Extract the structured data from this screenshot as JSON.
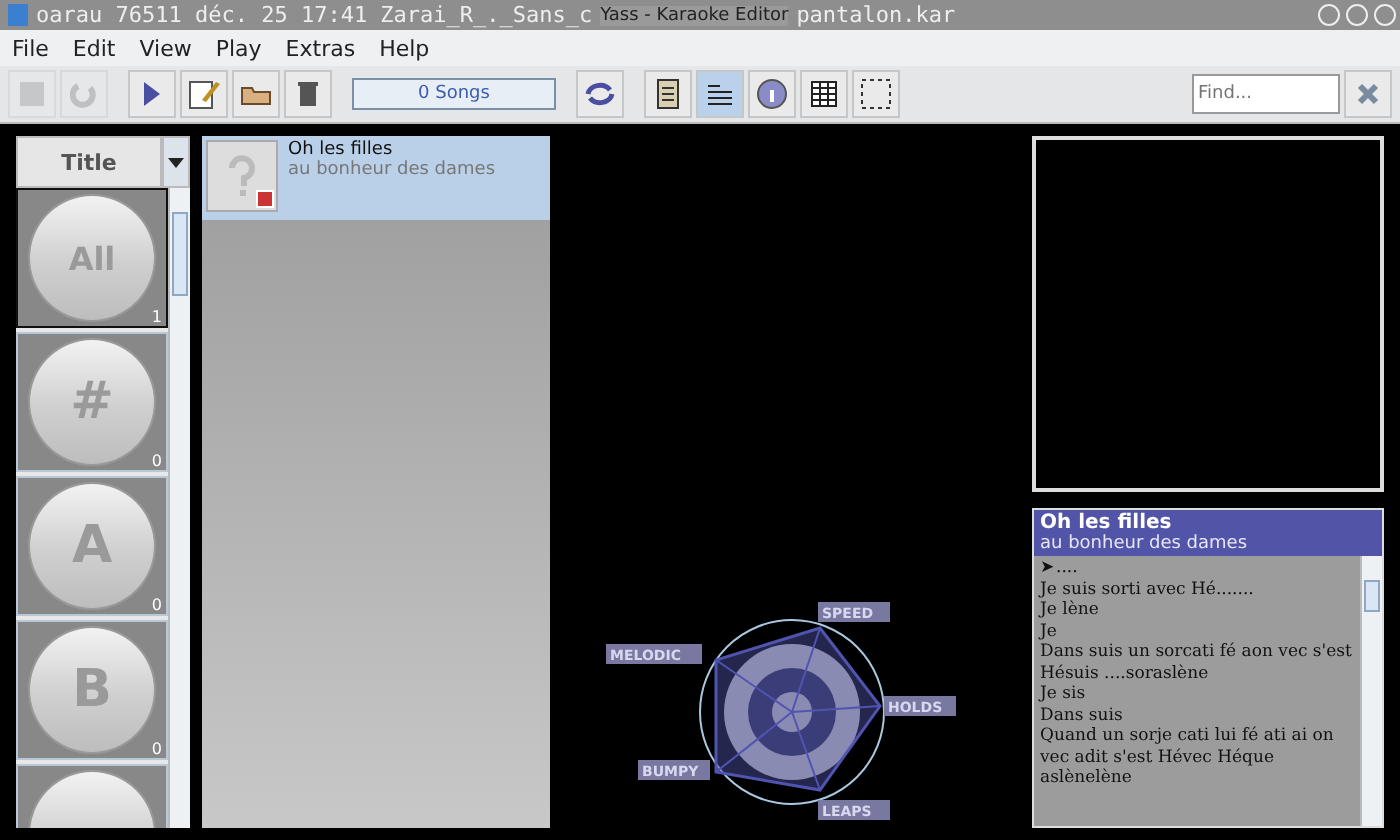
{
  "window": {
    "title": "Yass - Karaoke Editor",
    "background_text": [
      "oarau   76511 déc.  25 17:41 Zarai_R_._Sans_c",
      "pantalon.kar"
    ]
  },
  "menu": [
    "File",
    "Edit",
    "View",
    "Play",
    "Extras",
    "Help"
  ],
  "toolbar": [
    {
      "kind": "save",
      "disabled": true,
      "selected": false
    },
    {
      "kind": "redo",
      "disabled": true,
      "selected": false
    },
    {
      "kind": "play",
      "disabled": false,
      "selected": false
    },
    {
      "kind": "edit",
      "disabled": false,
      "selected": false
    },
    {
      "kind": "open",
      "disabled": false,
      "selected": false
    },
    {
      "kind": "trash",
      "disabled": false,
      "selected": false
    },
    {
      "kind": "count",
      "label": "0 Songs"
    },
    {
      "kind": "refresh",
      "disabled": false,
      "selected": false
    },
    {
      "kind": "list",
      "disabled": false,
      "selected": false
    },
    {
      "kind": "lyrics",
      "disabled": false,
      "selected": true
    },
    {
      "kind": "info",
      "disabled": false,
      "selected": false
    },
    {
      "kind": "grid",
      "disabled": false,
      "selected": false
    },
    {
      "kind": "dashed",
      "disabled": false,
      "selected": false
    }
  ],
  "search": {
    "placeholder": "Find..."
  },
  "sort": {
    "value": "Title"
  },
  "groups": [
    {
      "label": "All",
      "count": "1",
      "selected": true
    },
    {
      "label": "#",
      "count": "0",
      "selected": false
    },
    {
      "label": "A",
      "count": "0",
      "selected": false
    },
    {
      "label": "B",
      "count": "0",
      "selected": false
    },
    {
      "selected": false
    }
  ],
  "songs": [
    {
      "title": "Oh les filles",
      "artist": "au bonheur des dames",
      "selected": true
    }
  ],
  "radar": {
    "labels": [
      "SPEED",
      "HOLDS",
      "LEAPS",
      "BUMPY",
      "MELODIC"
    ]
  },
  "lyrics": {
    "title": "Oh les filles",
    "artist": "au bonheur des dames",
    "lines": [
      "➤....",
      "Je suis sorti avec Hé.......",
      "Je lène",
      "Je",
      "Dans suis un sorcati fé aon vec s'est Hésuis ....soraslène",
      "Je sis",
      "Dans suis",
      "Quand un sorje cati lui fé ati ai on vec adit s'est Hévec Héque aslènelène"
    ]
  }
}
